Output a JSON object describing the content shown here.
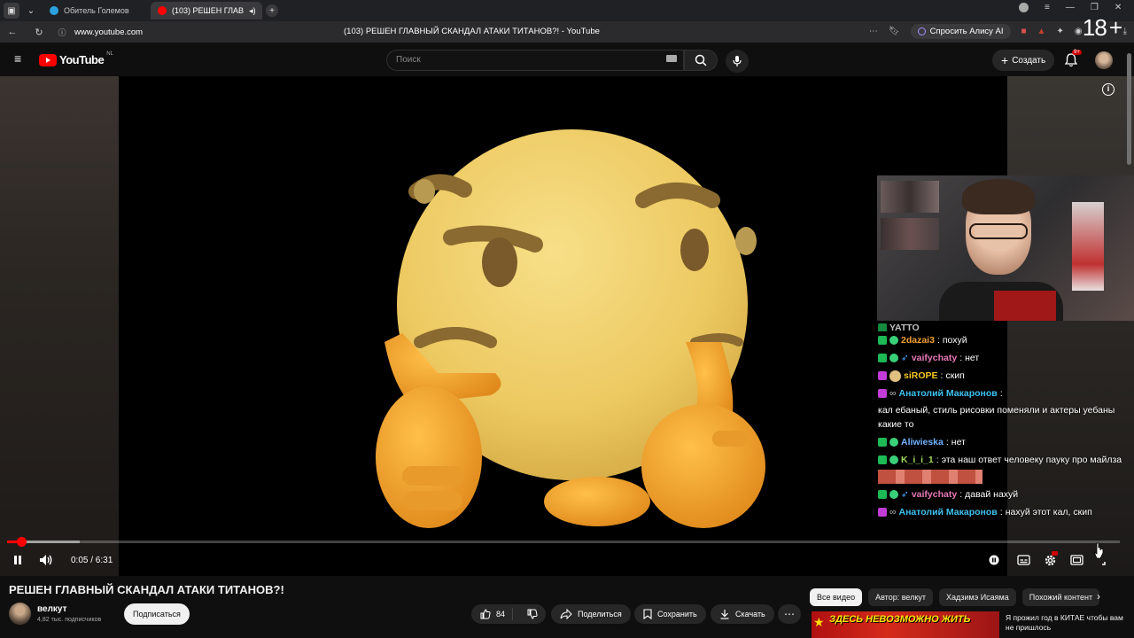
{
  "browser": {
    "tabs": [
      {
        "label": "Обитель Големов",
        "active": false,
        "favicon_color": "#2aa3e0"
      },
      {
        "label": "(103) РЕШЕН ГЛАВ",
        "active": true,
        "favicon_color": "#ff0000"
      }
    ],
    "url": "www.youtube.com",
    "page_title": "(103) РЕШЕН ГЛАВНЫЙ СКАНДАЛ АТАКИ ТИТАНОВ?! - YouTube",
    "alice_label": "Спросить Алису AI",
    "overlay_number": "18"
  },
  "header": {
    "logo_text": "YouTube",
    "logo_region": "NL",
    "search_placeholder": "Поиск",
    "create_label": "Создать",
    "notification_count": "9+"
  },
  "player": {
    "time_display": "0:05 / 6:31",
    "played_fraction": 0.013,
    "buffered_fraction": 0.065,
    "chat": [
      {
        "name": "YATTO",
        "message": "",
        "name_color": "#ffffff",
        "badge_color": "#1db954"
      },
      {
        "name": "2dazai3",
        "message": "похуй",
        "name_color": "#f0a030",
        "badge_color": "#1db954"
      },
      {
        "name": "vaifychaty",
        "message": "нет",
        "name_color": "#e879b9",
        "badge_color": "#1db954"
      },
      {
        "name": "siROPE",
        "message": "скип",
        "name_color": "#f3c623",
        "badge_color": "#c23dd8"
      },
      {
        "name": "Анатолий Макаронов",
        "message": "кал ебаный, стиль рисовки поменяли и актеры уебаны какие то",
        "name_color": "#3ec1f0",
        "badge_color": "#c23dd8"
      },
      {
        "name": "Aliwieska",
        "message": "нет",
        "name_color": "#6fb2ff",
        "badge_color": "#1db954"
      },
      {
        "name": "K_i_i_1",
        "message": "эта наш ответ человеку пауку про майлза",
        "name_color": "#9dd85a",
        "badge_color": "#1db954"
      },
      {
        "name": "vaifychaty",
        "message": "давай нахуй",
        "name_color": "#e879b9",
        "badge_color": "#1db954"
      },
      {
        "name": "Анатолий Макаронов",
        "message": "нахуй этот кал, скип",
        "name_color": "#3ec1f0",
        "badge_color": "#c23dd8"
      }
    ]
  },
  "video": {
    "title": "РЕШЕН ГЛАВНЫЙ СКАНДАЛ АТАКИ ТИТАНОВ?!",
    "channel_name": "велкут",
    "subscribers": "4,82 тыс. подписчиков",
    "subscribe_label": "Подписаться",
    "likes": "84",
    "share_label": "Поделиться",
    "save_label": "Сохранить",
    "download_label": "Скачать"
  },
  "recommendations": {
    "chips": [
      "Все видео",
      "Автор: велкут",
      "Хадзимэ Исаяма",
      "Похожий контент"
    ],
    "first_thumb_text": "ЗДЕСЬ НЕВОЗМОЖНО ЖИТЬ",
    "first_title": "Я прожил год в КИТАЕ чтобы вам не пришлось"
  },
  "colors": {
    "brand_red": "#ff0000",
    "background": "#0f0f0f",
    "emoji_yellow": "#f2cf6a"
  }
}
